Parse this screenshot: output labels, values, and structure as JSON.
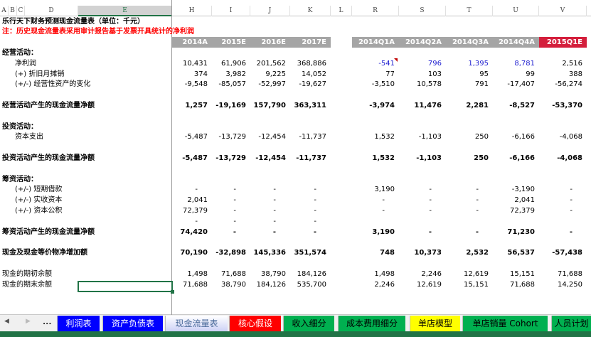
{
  "columns": [
    "A",
    "B",
    "C",
    "D",
    "E",
    "H",
    "I",
    "J",
    "K",
    "L",
    "R",
    "S",
    "T",
    "U",
    "V"
  ],
  "title": "乐行天下财务预测现金流量表（单位：千元）",
  "note": "注：历史现金流量表采用审计报告基于发票开具统计的净利润",
  "periods": [
    "2014A",
    "2015E",
    "2016E",
    "2017E",
    "",
    "2014Q1A",
    "2014Q2A",
    "2014Q3A",
    "2014Q4A",
    "2015Q1E"
  ],
  "colors": {
    "header_gray": "#a5a5a5",
    "highlight_red": "#d41f3c",
    "note_red": "#ff0000",
    "blue_values": "#1f1fd0",
    "excel_green": "#217346"
  },
  "rows": [
    {
      "label": "经营活动：",
      "bold": true,
      "indent": false,
      "values": []
    },
    {
      "label": "净利润",
      "indent": true,
      "values": [
        "10,431",
        "61,906",
        "201,562",
        "368,886",
        "-541",
        "796",
        "1,395",
        "8,781",
        "2,516"
      ],
      "blue": [
        4,
        5,
        6,
        7
      ],
      "comment": 4
    },
    {
      "label": "(+) 折旧月摊销",
      "indent": true,
      "values": [
        "374",
        "3,982",
        "9,225",
        "14,052",
        "77",
        "103",
        "95",
        "99",
        "388"
      ]
    },
    {
      "label": "(+/-) 经营性资产的变化",
      "indent": true,
      "values": [
        "-9,548",
        "-85,057",
        "-52,997",
        "-19,627",
        "-3,510",
        "10,578",
        "791",
        "-17,407",
        "-56,274"
      ]
    },
    {
      "label": "",
      "values": []
    },
    {
      "label": "经营活动产生的现金流量净额",
      "bold": true,
      "values": [
        "1,257",
        "-19,169",
        "157,790",
        "363,311",
        "-3,974",
        "11,476",
        "2,281",
        "-8,527",
        "-53,370"
      ]
    },
    {
      "label": "",
      "values": []
    },
    {
      "label": "投资活动：",
      "bold": true,
      "values": []
    },
    {
      "label": "资本支出",
      "indent": true,
      "values": [
        "-5,487",
        "-13,729",
        "-12,454",
        "-11,737",
        "1,532",
        "-1,103",
        "250",
        "-6,166",
        "-4,068"
      ]
    },
    {
      "label": "",
      "values": []
    },
    {
      "label": "投资活动产生的现金流量净额",
      "bold": true,
      "values": [
        "-5,487",
        "-13,729",
        "-12,454",
        "-11,737",
        "1,532",
        "-1,103",
        "250",
        "-6,166",
        "-4,068"
      ]
    },
    {
      "label": "",
      "values": []
    },
    {
      "label": "筹资活动：",
      "bold": true,
      "values": []
    },
    {
      "label": "(+/-) 短期借款",
      "indent": true,
      "values": [
        "-",
        "-",
        "-",
        "-",
        "3,190",
        "-",
        "-",
        "-3,190",
        "-"
      ]
    },
    {
      "label": "(+/-) 实收资本",
      "indent": true,
      "values": [
        "2,041",
        "-",
        "-",
        "-",
        "-",
        "-",
        "-",
        "2,041",
        "-"
      ]
    },
    {
      "label": "(+/-) 资本公积",
      "indent": true,
      "values": [
        "72,379",
        "-",
        "-",
        "-",
        "-",
        "-",
        "-",
        "72,379",
        "-"
      ]
    },
    {
      "label": "",
      "values": [
        "-",
        "-",
        "-",
        "-",
        "",
        "",
        "",
        "",
        ""
      ]
    },
    {
      "label": "筹资活动产生的现金流量净额",
      "bold": true,
      "values": [
        "74,420",
        "-",
        "-",
        "-",
        "3,190",
        "-",
        "-",
        "71,230",
        "-"
      ]
    },
    {
      "label": "",
      "values": []
    },
    {
      "label": "现金及现金等价物净增加额",
      "bold": true,
      "values": [
        "70,190",
        "-32,898",
        "145,336",
        "351,574",
        "748",
        "10,373",
        "2,532",
        "56,537",
        "-57,438"
      ]
    },
    {
      "label": "",
      "values": []
    },
    {
      "label": "现金的期初余额",
      "values": [
        "1,498",
        "71,688",
        "38,790",
        "184,126",
        "1,498",
        "2,246",
        "12,619",
        "15,151",
        "71,688"
      ]
    },
    {
      "label": "现金的期末余额",
      "values": [
        "71,688",
        "38,790",
        "184,126",
        "535,700",
        "2,246",
        "12,619",
        "15,151",
        "71,688",
        "14,250"
      ]
    }
  ],
  "sheet_nav": {
    "prev": "◀",
    "next": "▶",
    "more": "..."
  },
  "tabs": [
    {
      "label": "利润表",
      "bg": "#0000ff",
      "fg": "#ffffff"
    },
    {
      "label": "资产负债表",
      "bg": "#0000ff",
      "fg": "#ffffff"
    },
    {
      "label": "现金流量表",
      "bg": "#c8cdf5",
      "fg": "#4a6a9a",
      "active": true
    },
    {
      "label": "核心假设",
      "bg": "#ff0000",
      "fg": "#ffffff"
    },
    {
      "label": "收入细分",
      "bg": "#00b050",
      "fg": "#000000"
    },
    {
      "label": "成本费用细分",
      "bg": "#00b050",
      "fg": "#000000"
    },
    {
      "label": "单店模型",
      "bg": "#ffff00",
      "fg": "#000000"
    },
    {
      "label": "单店销量 Cohort",
      "bg": "#00b050",
      "fg": "#000000"
    },
    {
      "label": "人员计划",
      "bg": "#00b050",
      "fg": "#000000"
    }
  ]
}
